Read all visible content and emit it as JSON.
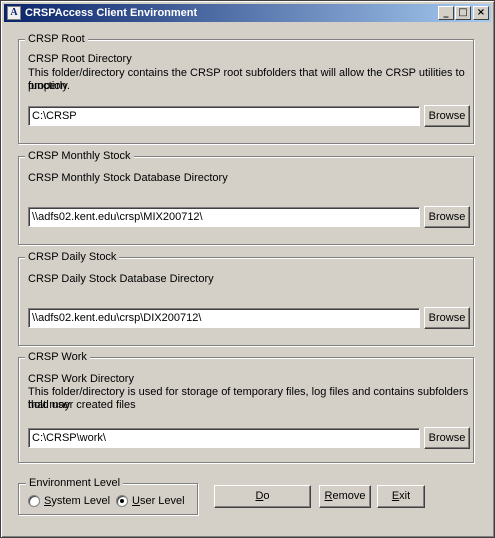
{
  "window": {
    "title": "CRSPAccess Client Environment",
    "icon_letter": "A",
    "minimize_glyph": "_",
    "maximize_glyph": "□",
    "close_glyph": "×"
  },
  "groups": {
    "root": {
      "legend": "CRSP Root",
      "heading": "CRSP Root Directory",
      "description_line1": "This folder/directory contains the CRSP root subfolders that will allow the CRSP utilities to function",
      "description_line2": "properly.",
      "path": "C:\\CRSP",
      "browse_label": "Browse"
    },
    "monthly": {
      "legend": "CRSP Monthly Stock",
      "heading": "CRSP Monthly Stock Database Directory",
      "path": "\\\\adfs02.kent.edu\\crsp\\MIX200712\\",
      "browse_label": "Browse"
    },
    "daily": {
      "legend": "CRSP Daily Stock",
      "heading": "CRSP Daily Stock Database Directory",
      "path": "\\\\adfs02.kent.edu\\crsp\\DIX200712\\",
      "browse_label": "Browse"
    },
    "work": {
      "legend": "CRSP Work",
      "heading": "CRSP Work Directory",
      "description_line1": "This folder/directory is used for storage of temporary files, log files and contains subfolders that may",
      "description_line2": "hold user created files",
      "path": "C:\\CRSP\\work\\",
      "browse_label": "Browse"
    }
  },
  "environment": {
    "legend": "Environment Level",
    "system": {
      "first": "S",
      "rest": "ystem Level",
      "checked": false
    },
    "user": {
      "first": "U",
      "rest": "ser Level",
      "checked": true
    }
  },
  "actions": {
    "do": {
      "first": "D",
      "rest": "o"
    },
    "remove": {
      "first": "R",
      "rest": "emove"
    },
    "exit": {
      "first": "E",
      "rest": "xit"
    }
  }
}
